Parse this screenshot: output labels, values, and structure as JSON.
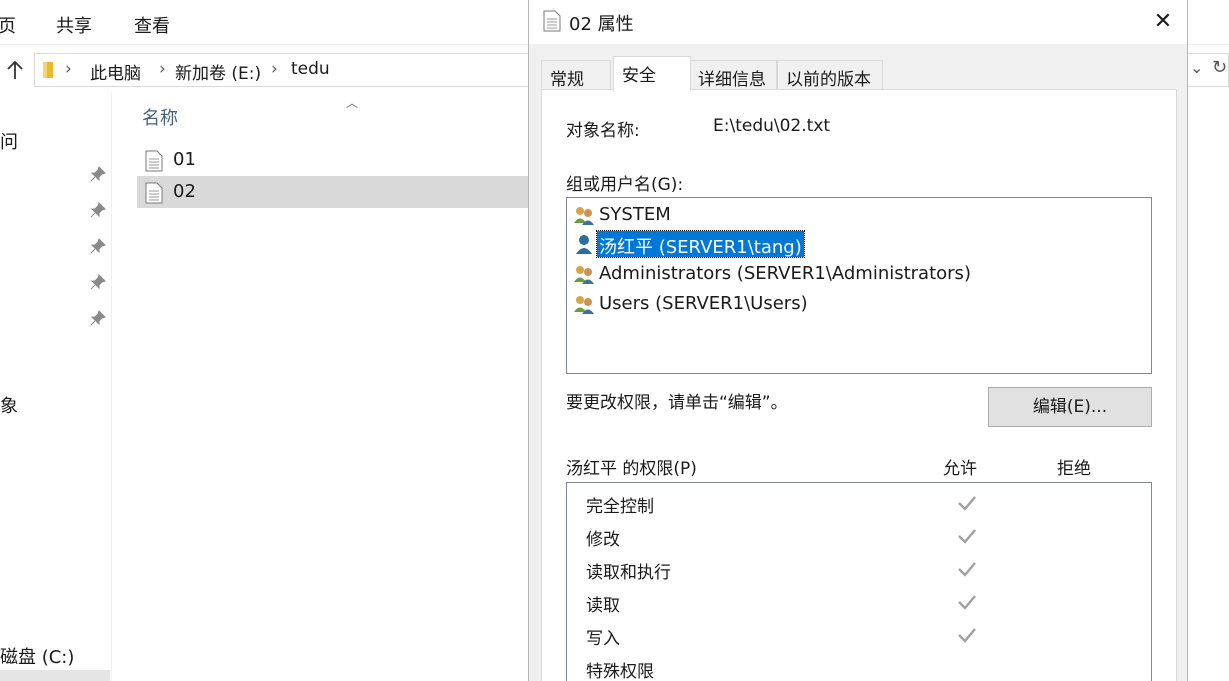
{
  "explorer": {
    "ribbon_tabs": [
      "页",
      "共享",
      "查看"
    ],
    "breadcrumb": [
      "此电脑",
      "新加卷 (E:)",
      "tedu"
    ],
    "nav_items": [
      {
        "label": "问",
        "pinned": false
      },
      {
        "label": "象",
        "pinned": false
      },
      {
        "label": "磁盘 (C:)",
        "pinned": false
      }
    ],
    "column_header": "名称",
    "files": [
      {
        "name": "01",
        "selected": false
      },
      {
        "name": "02",
        "selected": true
      }
    ]
  },
  "dialog": {
    "title": "02 属性",
    "close_glyph": "✕",
    "tabs": [
      {
        "label": "常规",
        "active": false
      },
      {
        "label": "安全",
        "active": true
      },
      {
        "label": "详细信息",
        "active": false
      },
      {
        "label": "以前的版本",
        "active": false
      }
    ],
    "object_name_label": "对象名称:",
    "object_name_value": "E:\\tedu\\02.txt",
    "groups_label": "组或用户名(G):",
    "users": [
      {
        "name": "SYSTEM",
        "icon": "group-icon",
        "selected": false
      },
      {
        "name": "汤红平 (SERVER1\\tang)",
        "icon": "user-icon",
        "selected": true
      },
      {
        "name": "Administrators (SERVER1\\Administrators)",
        "icon": "group-icon",
        "selected": false
      },
      {
        "name": "Users (SERVER1\\Users)",
        "icon": "group-icon",
        "selected": false
      }
    ],
    "edit_hint": "要更改权限，请单击“编辑”。",
    "edit_button": "编辑(E)...",
    "permissions_label": "汤红平 的权限(P)",
    "allow_header": "允许",
    "deny_header": "拒绝",
    "permissions": [
      {
        "name": "完全控制",
        "allow": true,
        "deny": false
      },
      {
        "name": "修改",
        "allow": true,
        "deny": false
      },
      {
        "name": "读取和执行",
        "allow": true,
        "deny": false
      },
      {
        "name": "读取",
        "allow": true,
        "deny": false
      },
      {
        "name": "写入",
        "allow": true,
        "deny": false
      },
      {
        "name": "特殊权限",
        "allow": false,
        "deny": false
      }
    ],
    "colors": {
      "selection": "#0078d7",
      "check": "#a0a0a0",
      "user_icon": "#2a6f9b"
    }
  }
}
